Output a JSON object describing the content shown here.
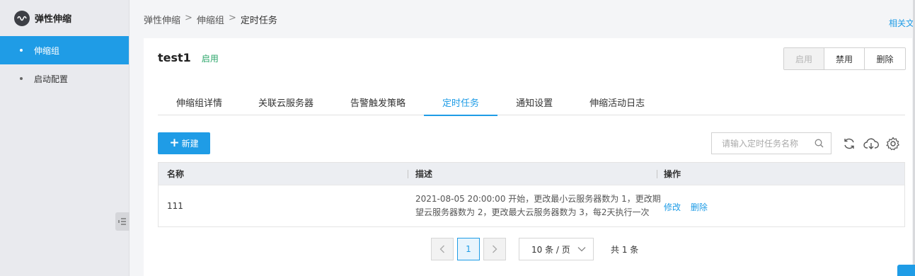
{
  "sidebar": {
    "title": "弹性伸缩",
    "items": [
      {
        "label": "伸缩组",
        "active": true
      },
      {
        "label": "启动配置",
        "active": false
      }
    ]
  },
  "breadcrumb": [
    "弹性伸缩",
    "伸缩组",
    "定时任务"
  ],
  "doc_link": "相关文",
  "header": {
    "title": "test1",
    "status": "启用",
    "actions": {
      "enable": "启用",
      "disable": "禁用",
      "delete": "删除"
    }
  },
  "tabs": [
    "伸缩组详情",
    "关联云服务器",
    "告警触发策略",
    "定时任务",
    "通知设置",
    "伸缩活动日志"
  ],
  "active_tab": "定时任务",
  "toolbar": {
    "new_label": "新建",
    "search_placeholder": "请输入定时任务名称",
    "icons": [
      "refresh-icon",
      "cloud-download-icon",
      "gear-icon"
    ]
  },
  "table": {
    "columns": [
      "名称",
      "描述",
      "操作"
    ],
    "rows": [
      {
        "name": "111",
        "description_line1": "2021-08-05 20:00:00 开始，更改最小云服务器数为 1，更改期",
        "description_line2": "望云服务器数为 2，更改最大云服务器数为 3，每2天执行一次",
        "actions": [
          "修改",
          "删除"
        ]
      }
    ]
  },
  "pagination": {
    "current_page": "1",
    "page_size": "10 条 / 页",
    "total": "共 1 条"
  },
  "colors": {
    "accent": "#1f9ce6",
    "status_green": "#2ba66a"
  }
}
